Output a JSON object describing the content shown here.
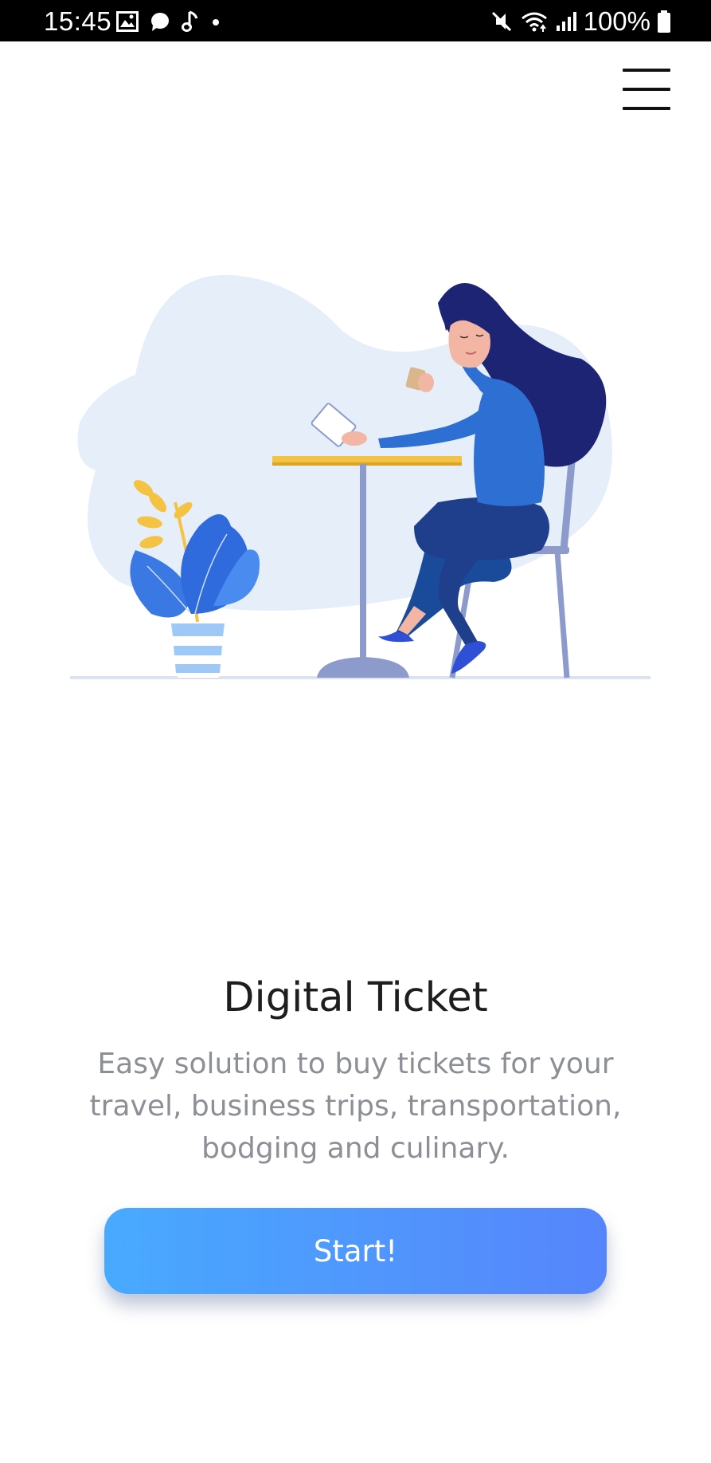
{
  "status_bar": {
    "time": "15:45",
    "battery": "100%",
    "left_icons": [
      "image-icon",
      "chat-bubble-icon",
      "music-note-icon",
      "dot-icon"
    ],
    "right_icons": [
      "mute-icon",
      "wifi-icon",
      "signal-icon",
      "battery-icon"
    ]
  },
  "header": {
    "menu_icon": "hamburger-menu-icon"
  },
  "hero": {
    "illustration": "woman-at-cafe-table-illustration",
    "title": "Digital Ticket",
    "description": "Easy solution to buy tickets for your travel, business trips, transportation, bodging and culinary.",
    "cta_label": "Start!"
  },
  "colors": {
    "accent_start": "#48aaff",
    "accent_end": "#5685fb",
    "title_text": "#1e1e1e",
    "body_text": "#8c8f96",
    "status_bar_bg": "#000000"
  }
}
